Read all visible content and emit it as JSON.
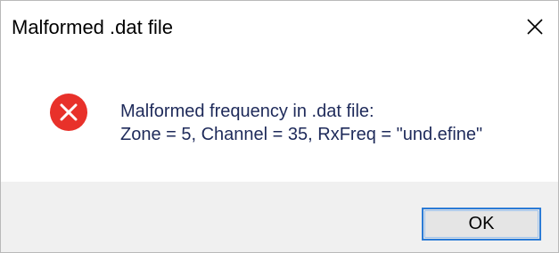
{
  "window": {
    "title": "Malformed .dat file",
    "close_icon": "close-icon"
  },
  "message": {
    "icon": "error-icon",
    "line1": "Malformed frequency in .dat file:",
    "line2": "Zone = 5, Channel = 35, RxFreq = \"und.efine\""
  },
  "buttons": {
    "ok_label": "OK"
  },
  "colors": {
    "error_red": "#e8312a",
    "message_text": "#1e2a5a",
    "footer_bg": "#f0f0f0",
    "focus_border": "#2b7bd6"
  }
}
